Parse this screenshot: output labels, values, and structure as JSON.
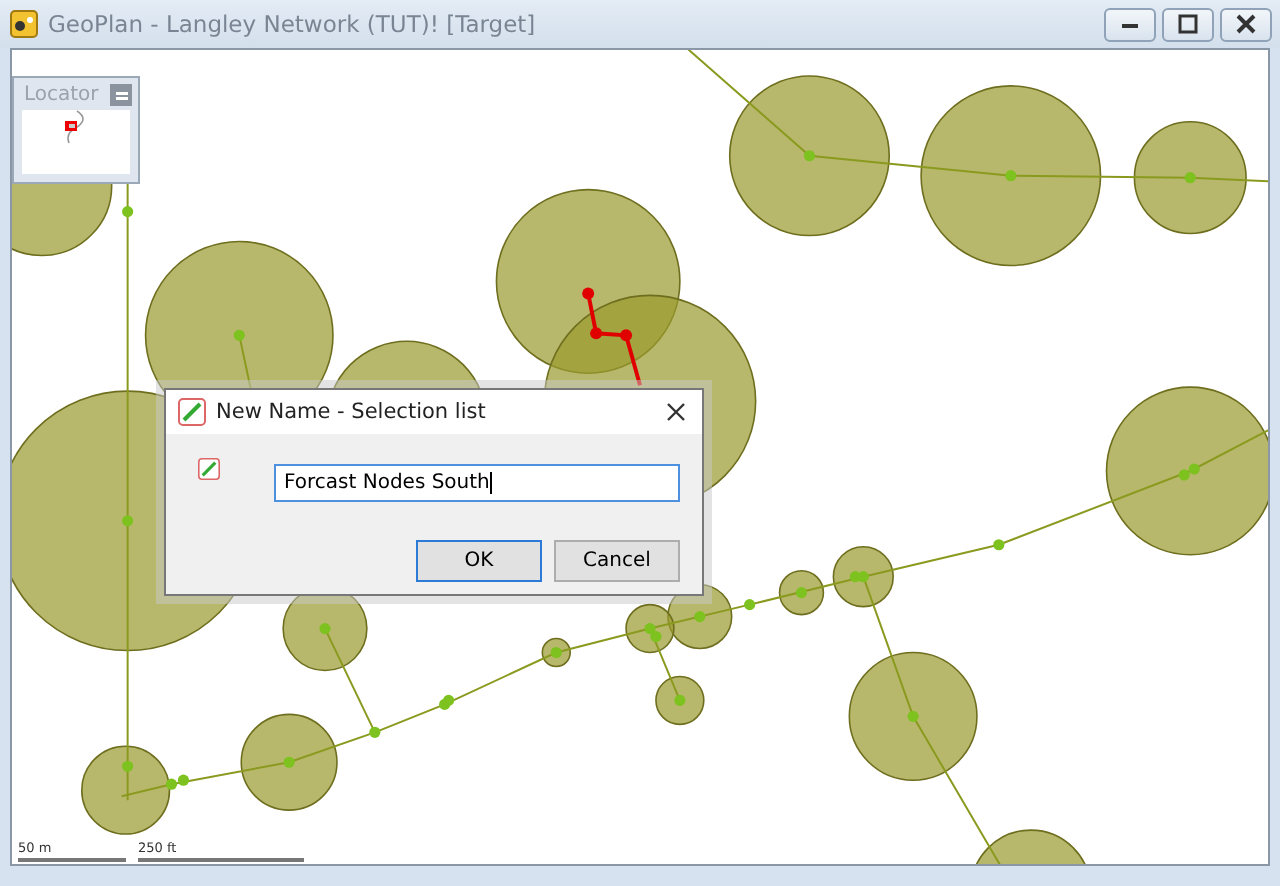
{
  "window": {
    "title": "GeoPlan - Langley Network (TUT)! [Target]"
  },
  "locator": {
    "title": "Locator"
  },
  "dialog": {
    "title": "New Name - Selection list",
    "input": {
      "value": "Forcast Nodes South",
      "focused": true
    },
    "buttons": [
      {
        "label": "OK",
        "kind": "default"
      },
      {
        "label": "Cancel",
        "kind": "normal"
      }
    ]
  },
  "scale_bar": [
    {
      "label": "50 m"
    },
    {
      "label": "250 ft"
    }
  ]
}
